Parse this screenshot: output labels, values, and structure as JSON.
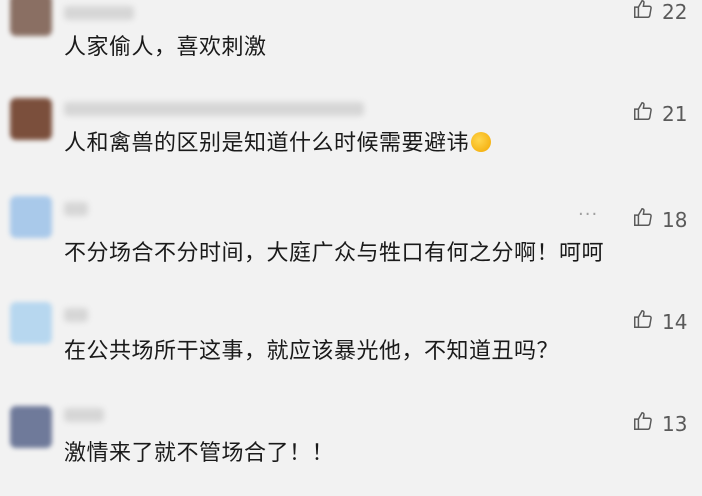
{
  "comments": [
    {
      "text": "人家偷人，喜欢刺激",
      "likes": "22",
      "avatar_color": "#8a6f63"
    },
    {
      "text": "人和禽兽的区别是知道什么时候需要避讳",
      "likes": "21",
      "avatar_color": "#7b4f3c",
      "emoji": "face-with-tears-of-joy"
    },
    {
      "text": "不分场合不分时间，大庭广众与牲口有何之分啊！呵呵",
      "likes": "18",
      "avatar_color": "#a9c9ea",
      "more_icon": "more-icon"
    },
    {
      "text": "在公共场所干这事，就应该暴光他，不知道丑吗？",
      "likes": "14",
      "avatar_color": "#b7d7ef"
    },
    {
      "text": "激情来了就不管场合了！！",
      "likes": "13",
      "avatar_color": "#6f7a9a"
    }
  ],
  "icons": {
    "like": "thumbs-up-icon",
    "more": "ellipsis-icon"
  }
}
